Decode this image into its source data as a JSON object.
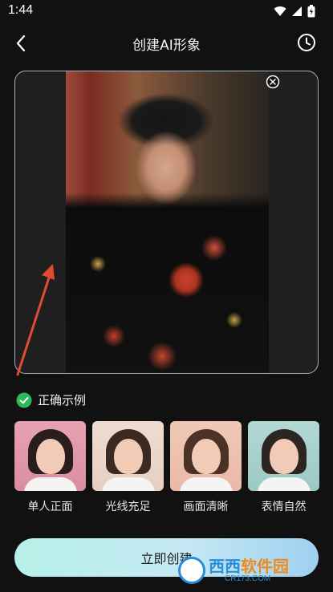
{
  "status_bar": {
    "time": "1:44",
    "icons": [
      "wifi-icon",
      "signal-icon",
      "battery-icon"
    ]
  },
  "header": {
    "title": "创建AI形象",
    "back_icon": "chevron-left-icon",
    "history_icon": "clock-icon"
  },
  "upload": {
    "close_icon": "close-circle-icon",
    "frame_color": "#9ab7c8"
  },
  "examples": {
    "title": "正确示例",
    "check_color": "#2fb85a",
    "items": [
      {
        "label": "单人正面",
        "bg": "#d98ea0",
        "hair": "#2a1d1f"
      },
      {
        "label": "光线充足",
        "bg": "#e6cfc2",
        "hair": "#3a2a22"
      },
      {
        "label": "画面清晰",
        "bg": "#e9b9a6",
        "hair": "#4a3226"
      },
      {
        "label": "表情自然",
        "bg": "#9cc8c4",
        "hair": "#2d2522"
      }
    ]
  },
  "create_button": {
    "label": "立即创建"
  },
  "watermark": {
    "brand_a": "西西",
    "brand_b": "软件园",
    "url": "CR173.COM"
  },
  "colors": {
    "background": "#111111",
    "accent_gradient_start": "#b6f0e8",
    "accent_gradient_end": "#9fd0f0",
    "annotation_arrow": "#e24a36"
  }
}
